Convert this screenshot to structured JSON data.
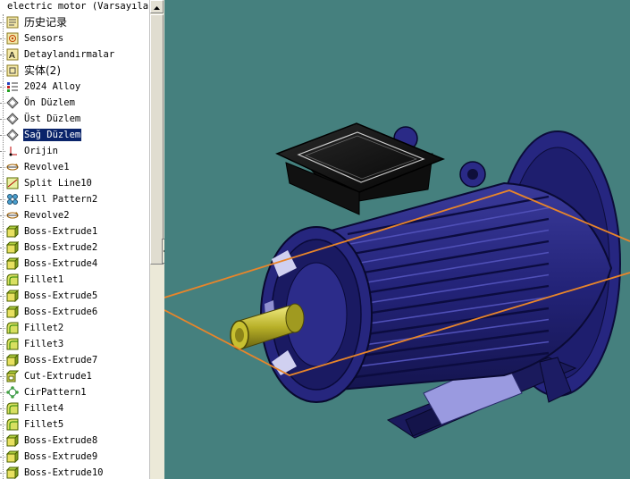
{
  "tree": {
    "header": "electric motor  (Varsayılan",
    "items": [
      {
        "label": "历史记录",
        "icon": "history-icon",
        "cjk": true
      },
      {
        "label": "Sensors",
        "icon": "sensor-icon"
      },
      {
        "label": "Detaylandırmalar",
        "icon": "annotations-icon"
      },
      {
        "label": "实体(2)",
        "icon": "solid-bodies-icon",
        "cjk": true
      },
      {
        "label": "2024 Alloy",
        "icon": "material-icon"
      },
      {
        "label": "Ön Düzlem",
        "icon": "plane-icon"
      },
      {
        "label": "Üst Düzlem",
        "icon": "plane-icon"
      },
      {
        "label": "Sağ Düzlem",
        "icon": "plane-icon",
        "selected": true
      },
      {
        "label": "Orijin",
        "icon": "origin-icon"
      },
      {
        "label": "Revolve1",
        "icon": "revolve-icon"
      },
      {
        "label": "Split Line10",
        "icon": "split-line-icon"
      },
      {
        "label": "Fill Pattern2",
        "icon": "fill-pattern-icon"
      },
      {
        "label": "Revolve2",
        "icon": "revolve-icon"
      },
      {
        "label": "Boss-Extrude1",
        "icon": "boss-extrude-icon"
      },
      {
        "label": "Boss-Extrude2",
        "icon": "boss-extrude-icon"
      },
      {
        "label": "Boss-Extrude4",
        "icon": "boss-extrude-icon"
      },
      {
        "label": "Fillet1",
        "icon": "fillet-icon"
      },
      {
        "label": "Boss-Extrude5",
        "icon": "boss-extrude-icon"
      },
      {
        "label": "Boss-Extrude6",
        "icon": "boss-extrude-icon"
      },
      {
        "label": "Fillet2",
        "icon": "fillet-icon"
      },
      {
        "label": "Fillet3",
        "icon": "fillet-icon"
      },
      {
        "label": "Boss-Extrude7",
        "icon": "boss-extrude-icon"
      },
      {
        "label": "Cut-Extrude1",
        "icon": "cut-extrude-icon"
      },
      {
        "label": "CirPattern1",
        "icon": "circular-pattern-icon"
      },
      {
        "label": "Fillet4",
        "icon": "fillet-icon"
      },
      {
        "label": "Fillet5",
        "icon": "fillet-icon"
      },
      {
        "label": "Boss-Extrude8",
        "icon": "boss-extrude-icon"
      },
      {
        "label": "Boss-Extrude9",
        "icon": "boss-extrude-icon"
      },
      {
        "label": "Boss-Extrude10",
        "icon": "boss-extrude-icon"
      }
    ]
  },
  "viewport": {
    "background": "#45807e",
    "model": "electric-motor-model",
    "plane_color": "#e8852a",
    "body_color": "#1c1c6e",
    "shaft_color": "#c8c030"
  }
}
